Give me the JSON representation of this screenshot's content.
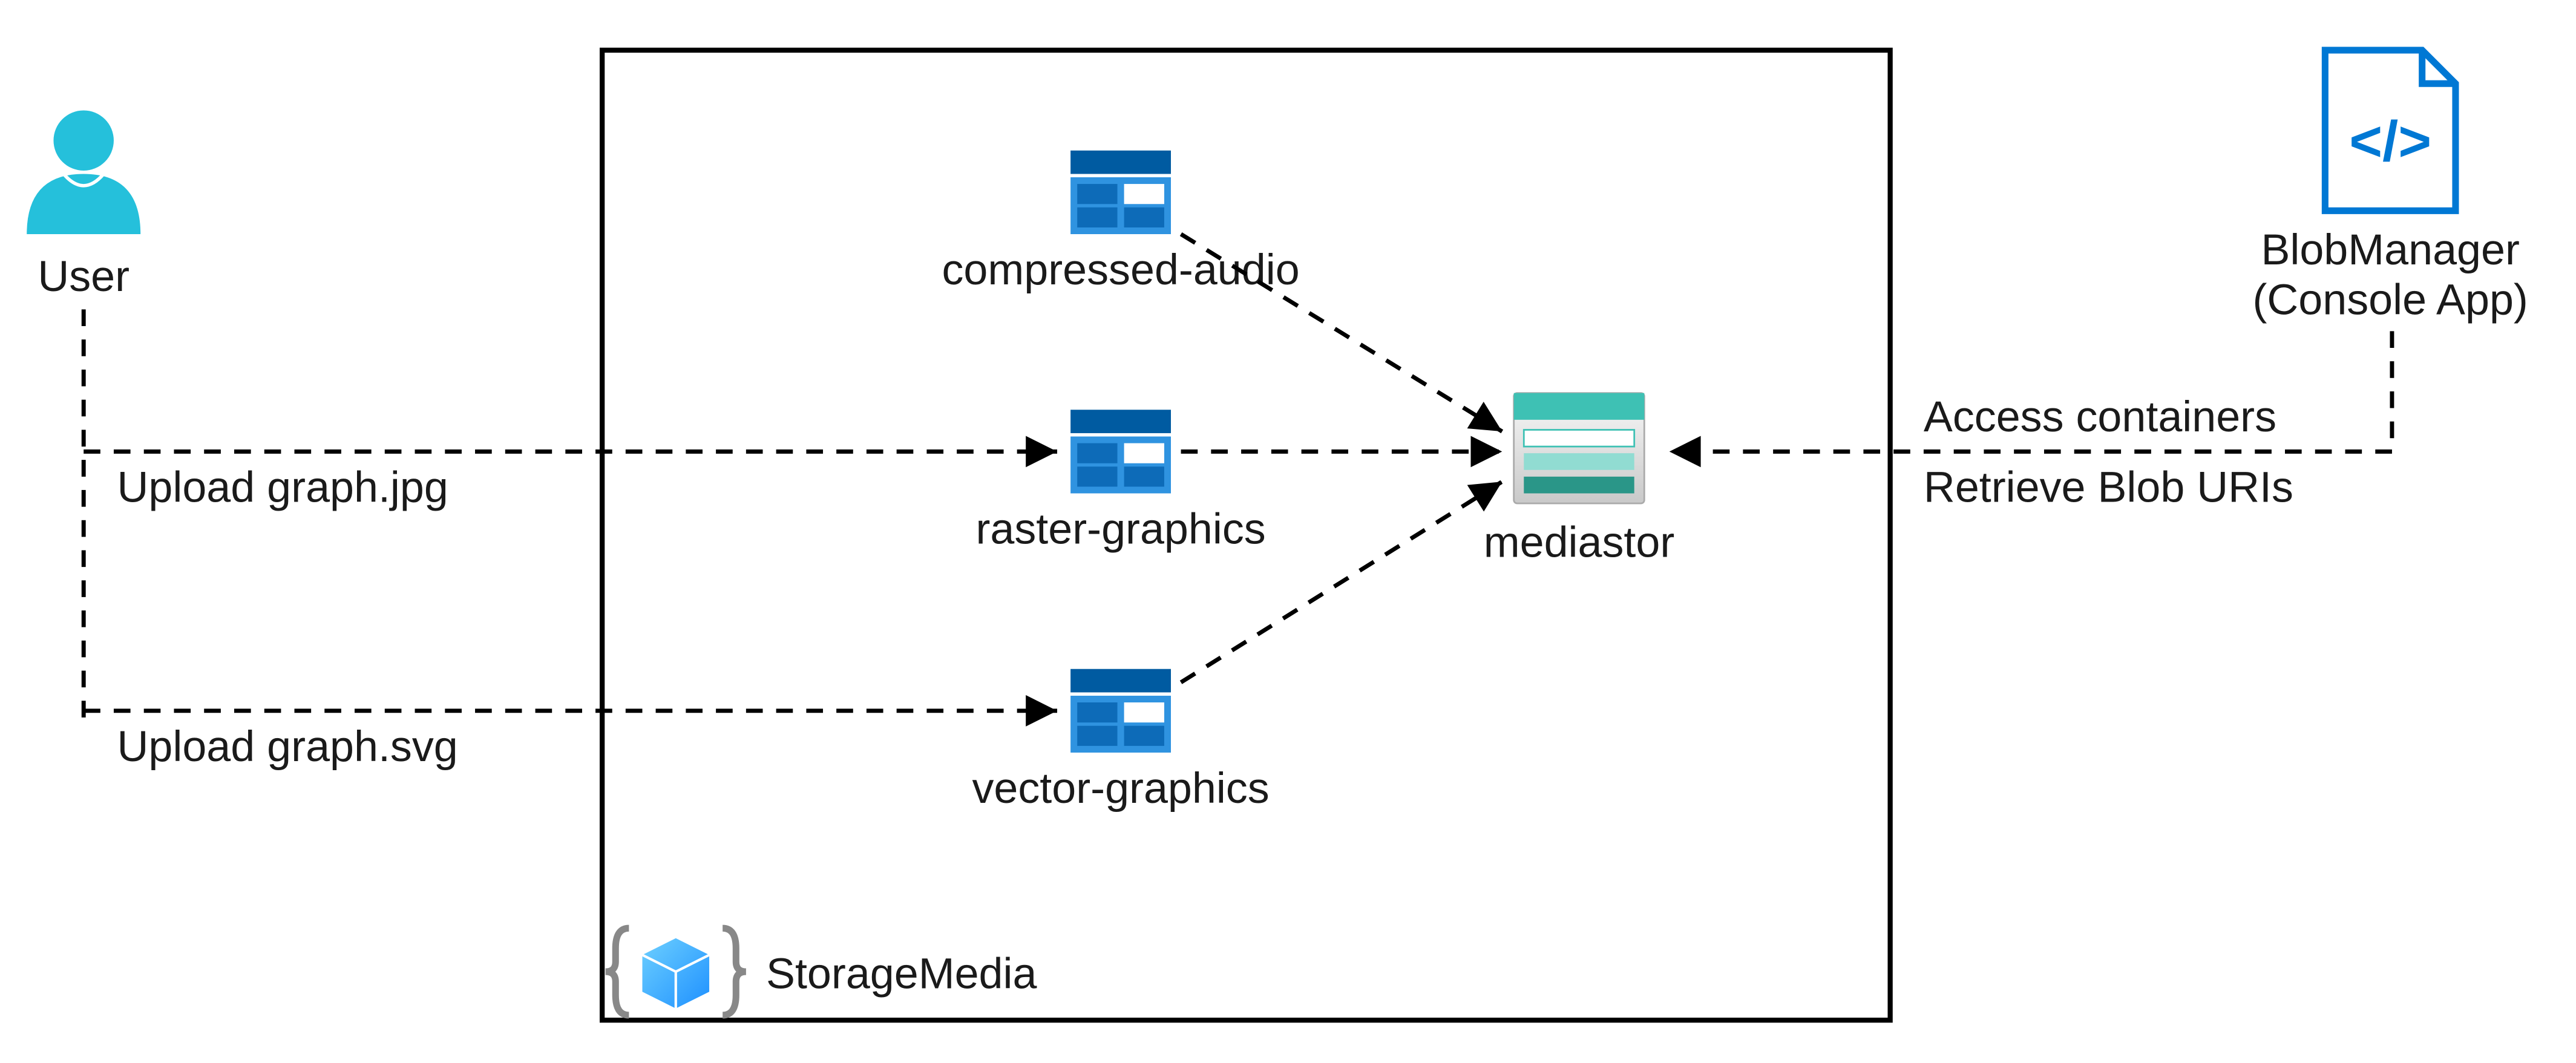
{
  "user": {
    "label": "User"
  },
  "resourceGroup": {
    "label": "StorageMedia"
  },
  "containers": {
    "compressed_audio": "compressed-audio",
    "raster_graphics": "raster-graphics",
    "vector_graphics": "vector-graphics"
  },
  "storage_account": {
    "label": "mediastor"
  },
  "app": {
    "line1": "BlobManager",
    "line2": "(Console App)"
  },
  "edges": {
    "upload_jpg": "Upload graph.jpg",
    "upload_svg": "Upload graph.svg",
    "access_containers": "Access containers",
    "retrieve_uris": "Retrieve Blob URIs"
  },
  "colors": {
    "azure_blue": "#0078D4",
    "teal": "#3EC1B4",
    "container_blue": "#2F93E0",
    "container_dark": "#005BA1",
    "user_teal": "#25C0DB",
    "box_border": "#000000"
  }
}
